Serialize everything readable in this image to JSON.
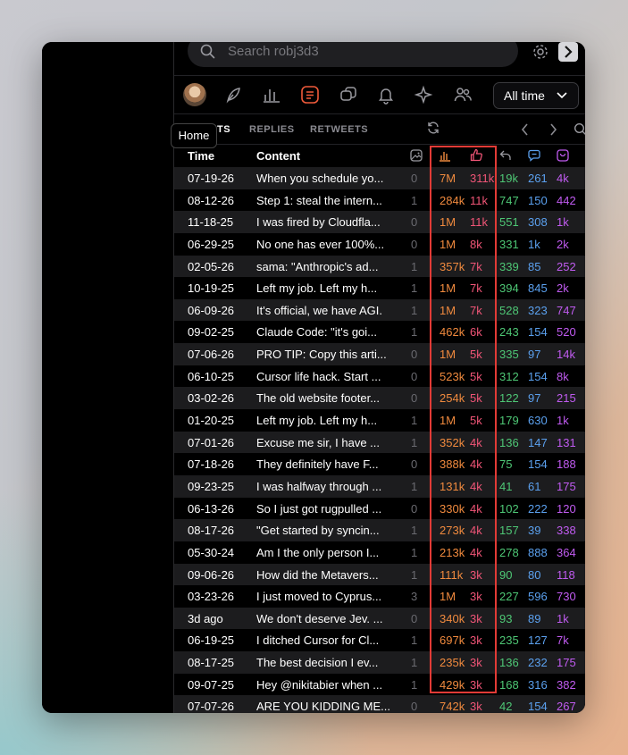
{
  "search": {
    "placeholder": "Search robj3d3"
  },
  "filter": {
    "label": "All time"
  },
  "tooltip": "Home",
  "tabs": [
    "POSTS",
    "REPLIES",
    "RETWEETS"
  ],
  "tab_visible": {
    "posts": "TS"
  },
  "columns": {
    "time": "Time",
    "content": "Content"
  },
  "colors": {
    "views": "#f08a3e",
    "likes": "#f05577",
    "retweets": "#4ec775",
    "replies": "#5ba0ee",
    "bookmarks": "#c05bf0",
    "highlight": "#e23b36"
  },
  "icons": [
    "search-icon",
    "gear-icon",
    "chevron-right-icon",
    "avatar",
    "feather-icon",
    "bar-chart-icon",
    "list-icon",
    "chat-bubbles-icon",
    "bell-icon",
    "sparkle-star-icon",
    "users-icon",
    "chevron-down-icon",
    "refresh-icon",
    "chevron-left-icon",
    "search-icon",
    "gear-icon",
    "image-icon",
    "bar-chart-icon",
    "thumbs-up-icon",
    "reply-arrow-icon",
    "comment-icon",
    "bookmark-icon"
  ],
  "rows": [
    {
      "time": "07-19-26",
      "content": "When you schedule yo...",
      "media": "0",
      "views": "7M",
      "likes": "311k",
      "retweets": "19k",
      "replies": "261",
      "bookmarks": "4k"
    },
    {
      "time": "08-12-26",
      "content": "Step 1: steal the intern...",
      "media": "1",
      "views": "284k",
      "likes": "11k",
      "retweets": "747",
      "replies": "150",
      "bookmarks": "442"
    },
    {
      "time": "11-18-25",
      "content": "I was fired by Cloudfla...",
      "media": "0",
      "views": "1M",
      "likes": "11k",
      "retweets": "551",
      "replies": "308",
      "bookmarks": "1k"
    },
    {
      "time": "06-29-25",
      "content": "No one has ever 100%...",
      "media": "0",
      "views": "1M",
      "likes": "8k",
      "retweets": "331",
      "replies": "1k",
      "bookmarks": "2k"
    },
    {
      "time": "02-05-26",
      "content": "sama: \"Anthropic's ad...",
      "media": "1",
      "views": "357k",
      "likes": "7k",
      "retweets": "339",
      "replies": "85",
      "bookmarks": "252"
    },
    {
      "time": "10-19-25",
      "content": "Left my job. Left my h...",
      "media": "1",
      "views": "1M",
      "likes": "7k",
      "retweets": "394",
      "replies": "845",
      "bookmarks": "2k"
    },
    {
      "time": "06-09-26",
      "content": "It's official, we have AGI.",
      "media": "1",
      "views": "1M",
      "likes": "7k",
      "retweets": "528",
      "replies": "323",
      "bookmarks": "747"
    },
    {
      "time": "09-02-25",
      "content": "Claude Code: \"it's goi...",
      "media": "1",
      "views": "462k",
      "likes": "6k",
      "retweets": "243",
      "replies": "154",
      "bookmarks": "520"
    },
    {
      "time": "07-06-26",
      "content": "PRO TIP: Copy this arti...",
      "media": "0",
      "views": "1M",
      "likes": "5k",
      "retweets": "335",
      "replies": "97",
      "bookmarks": "14k"
    },
    {
      "time": "06-10-25",
      "content": "Cursor life hack. Start ...",
      "media": "0",
      "views": "523k",
      "likes": "5k",
      "retweets": "312",
      "replies": "154",
      "bookmarks": "8k"
    },
    {
      "time": "03-02-26",
      "content": "The old website footer...",
      "media": "0",
      "views": "254k",
      "likes": "5k",
      "retweets": "122",
      "replies": "97",
      "bookmarks": "215"
    },
    {
      "time": "01-20-25",
      "content": "Left my job. Left my h...",
      "media": "1",
      "views": "1M",
      "likes": "5k",
      "retweets": "179",
      "replies": "630",
      "bookmarks": "1k"
    },
    {
      "time": "07-01-26",
      "content": "Excuse me sir, I have ...",
      "media": "1",
      "views": "352k",
      "likes": "4k",
      "retweets": "136",
      "replies": "147",
      "bookmarks": "131"
    },
    {
      "time": "07-18-26",
      "content": "They definitely have F...",
      "media": "0",
      "views": "388k",
      "likes": "4k",
      "retweets": "75",
      "replies": "154",
      "bookmarks": "188"
    },
    {
      "time": "09-23-25",
      "content": "I was halfway through ...",
      "media": "1",
      "views": "131k",
      "likes": "4k",
      "retweets": "41",
      "replies": "61",
      "bookmarks": "175"
    },
    {
      "time": "06-13-26",
      "content": "So I just got rugpulled ...",
      "media": "0",
      "views": "330k",
      "likes": "4k",
      "retweets": "102",
      "replies": "222",
      "bookmarks": "120"
    },
    {
      "time": "08-17-26",
      "content": "\"Get started by syncin...",
      "media": "1",
      "views": "273k",
      "likes": "4k",
      "retweets": "157",
      "replies": "39",
      "bookmarks": "338"
    },
    {
      "time": "05-30-24",
      "content": "Am I the only person I...",
      "media": "1",
      "views": "213k",
      "likes": "4k",
      "retweets": "278",
      "replies": "888",
      "bookmarks": "364"
    },
    {
      "time": "09-06-26",
      "content": "How did the Metavers...",
      "media": "1",
      "views": "111k",
      "likes": "3k",
      "retweets": "90",
      "replies": "80",
      "bookmarks": "118"
    },
    {
      "time": "03-23-26",
      "content": "I just moved to Cyprus...",
      "media": "3",
      "views": "1M",
      "likes": "3k",
      "retweets": "227",
      "replies": "596",
      "bookmarks": "730"
    },
    {
      "time": "3d ago",
      "content": "We don't deserve Jev. ...",
      "media": "0",
      "views": "340k",
      "likes": "3k",
      "retweets": "93",
      "replies": "89",
      "bookmarks": "1k"
    },
    {
      "time": "06-19-25",
      "content": "I ditched Cursor for Cl...",
      "media": "1",
      "views": "697k",
      "likes": "3k",
      "retweets": "235",
      "replies": "127",
      "bookmarks": "7k"
    },
    {
      "time": "08-17-25",
      "content": "The best decision I ev...",
      "media": "1",
      "views": "235k",
      "likes": "3k",
      "retweets": "136",
      "replies": "232",
      "bookmarks": "175"
    },
    {
      "time": "09-07-25",
      "content": "Hey @nikitabier when ...",
      "media": "1",
      "views": "429k",
      "likes": "3k",
      "retweets": "168",
      "replies": "316",
      "bookmarks": "382"
    },
    {
      "time": "07-07-26",
      "content": "ARE YOU KIDDING ME...",
      "media": "0",
      "views": "742k",
      "likes": "3k",
      "retweets": "42",
      "replies": "154",
      "bookmarks": "267"
    }
  ]
}
